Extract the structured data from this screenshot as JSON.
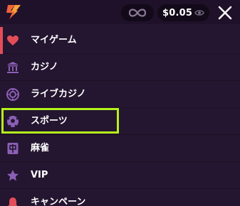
{
  "header": {
    "balance": "$0.05",
    "icons": {
      "logo": "lightning-logo-icon",
      "infinity": "infinity-icon",
      "eye": "eye-icon",
      "close": "close-icon"
    }
  },
  "menu": {
    "items": [
      {
        "label": "マイゲーム",
        "icon": "heart-icon"
      },
      {
        "label": "カジノ",
        "icon": "bank-icon"
      },
      {
        "label": "ライブカジノ",
        "icon": "chip-icon"
      },
      {
        "label": "スポーツ",
        "icon": "soccer-ball-icon"
      },
      {
        "label": "麻雀",
        "icon": "mahjong-tile-icon"
      },
      {
        "label": "VIP",
        "icon": "star-icon"
      },
      {
        "label": "キャンペーン",
        "icon": "bell-icon"
      }
    ],
    "active_index": 0,
    "highlighted_index": 3
  },
  "colors": {
    "background": "#241530",
    "header_background": "#1f1129",
    "icon_purple": "#8b5fb5",
    "active_accent": "#e34d58",
    "highlight_outline": "#b4f21b"
  }
}
